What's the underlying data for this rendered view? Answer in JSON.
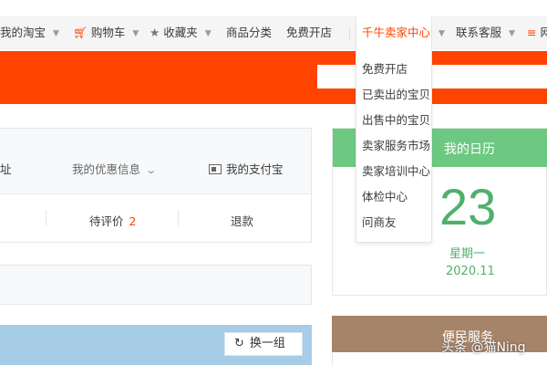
{
  "nav": {
    "my_taobao": "我的淘宝",
    "cart": "购物车",
    "favorites": "收藏夹",
    "categories": "商品分类",
    "open_store": "免费开店",
    "qianniu": "千牛卖家中心",
    "support": "联系客服",
    "sitemap": "网",
    "cart_icon": "cart-icon",
    "star_icon": "star-icon",
    "menu_icon": "menu-icon"
  },
  "qianniu_menu": [
    "免费开店",
    "已卖出的宝贝",
    "出售中的宝贝",
    "卖家服务市场",
    "卖家培训中心",
    "体检中心",
    "问商友"
  ],
  "account_panel": {
    "address_fragment": "址",
    "coupons": "我的优惠信息",
    "alipay": "我的支付宝",
    "to_review_label": "待评价",
    "to_review_count": "2",
    "refund": "退款"
  },
  "recommend": {
    "switch_label": "换一组"
  },
  "calendar": {
    "title": "我的日历",
    "day": "23",
    "weekday": "星期一",
    "year_month": "2020.11"
  },
  "service": {
    "title": "便民服务"
  },
  "watermark": "头条 @猫Ning",
  "colors": {
    "brand_orange": "#ff4400",
    "calendar_green": "#6dc982",
    "service_brown": "#a58469",
    "recommend_blue": "#a6cce8"
  }
}
